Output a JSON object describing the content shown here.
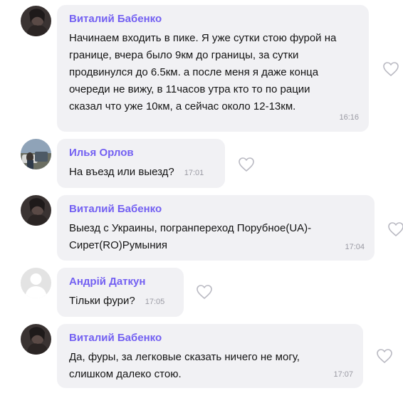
{
  "messages": [
    {
      "author": "Виталий Бабенко",
      "lines": [
        "Начинаем входить в пике. Я уже сутки стою фурой на",
        "границе, вчера было 9км до границы, за сутки",
        "продвинулся до 6.5км. а после меня я даже конца",
        "очереди не вижу, в 11часов утра кто то по рации",
        "сказал что уже 10км, а сейчас около 12-13км."
      ],
      "time": "16:16",
      "avatar": "dark-portrait-photo"
    },
    {
      "author": "Илья Орлов",
      "lines": [
        "На въезд или выезд?"
      ],
      "time": "17:01",
      "avatar": "outdoor-car-photo"
    },
    {
      "author": "Виталий Бабенко",
      "lines": [
        "Выезд с Украины, погранпереход Порубное(UA)-",
        "Сирет(RO)Румыния"
      ],
      "time": "17:04",
      "avatar": "dark-portrait-photo"
    },
    {
      "author": "Андрій Даткун",
      "lines": [
        "Тільки фури?"
      ],
      "time": "17:05",
      "avatar": "default-user-placeholder"
    },
    {
      "author": "Виталий Бабенко",
      "lines": [
        "Да, фуры, за легковые сказать ничего не могу,",
        "слишком далеко стою."
      ],
      "time": "17:07",
      "avatar": "dark-portrait-photo"
    }
  ],
  "colors": {
    "author_name": "#7360f2",
    "bubble_bg": "#f1f1f4",
    "timestamp": "#9a9aa3",
    "heart_outline": "#b9b9c2"
  },
  "icons": {
    "like": "heart-outline-icon"
  }
}
